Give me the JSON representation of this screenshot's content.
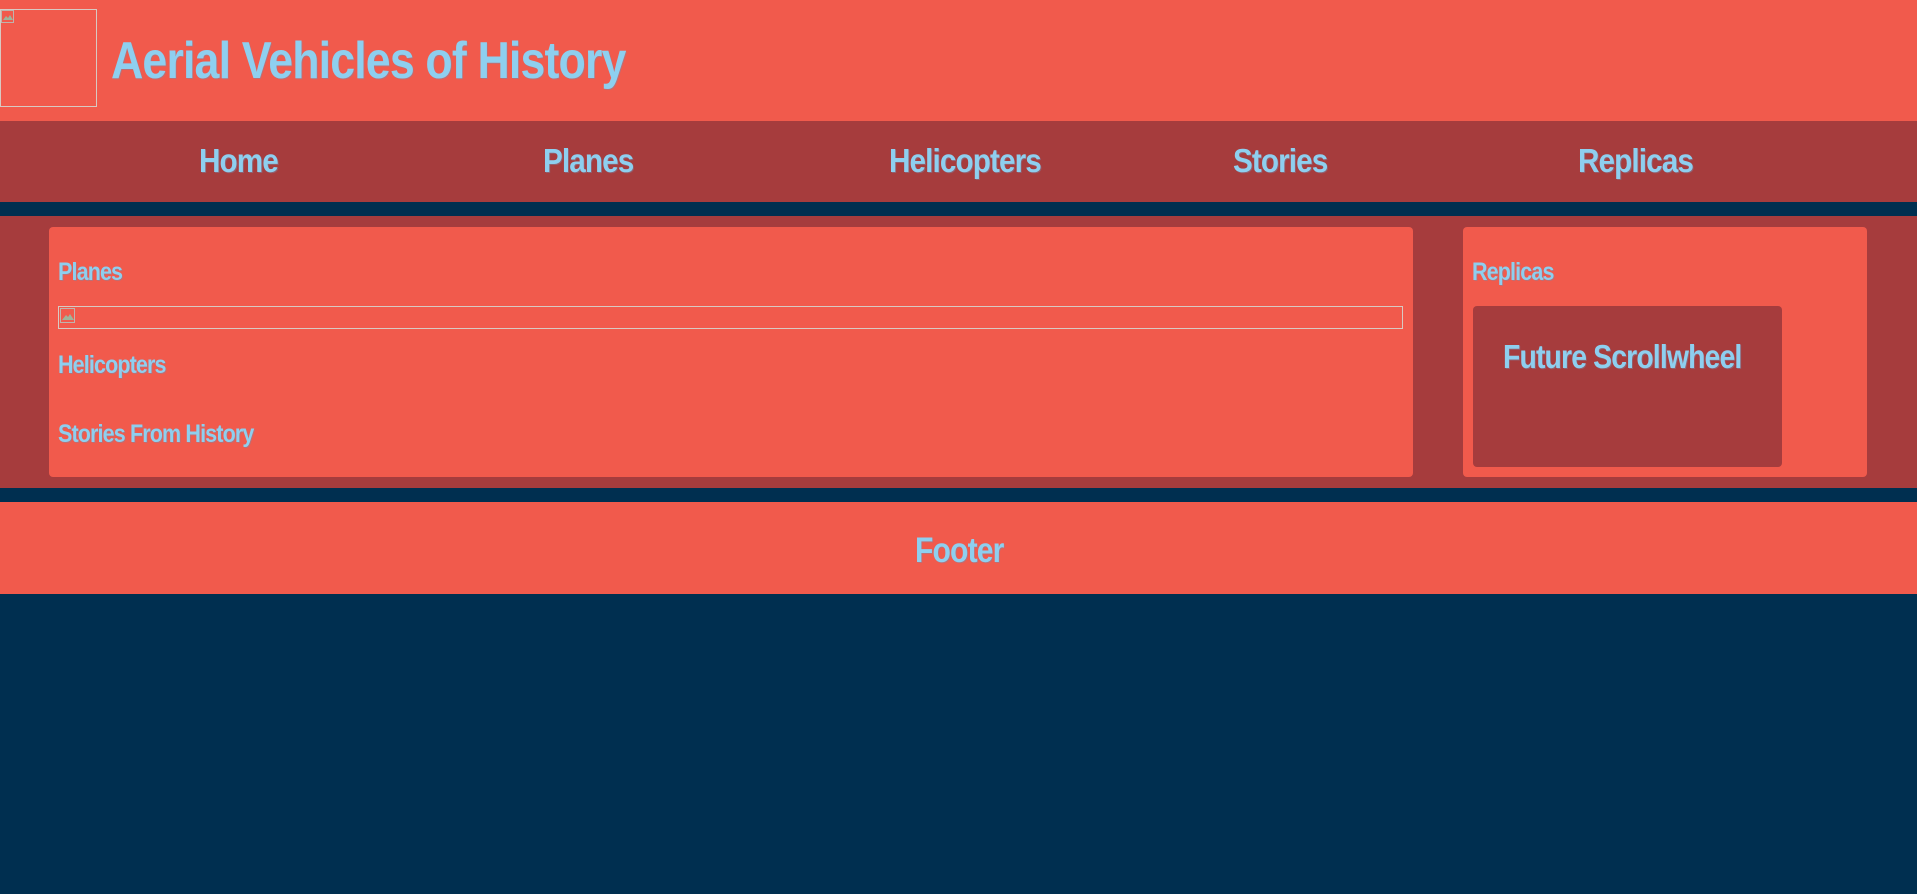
{
  "header": {
    "logo_icon": "broken-image-icon",
    "title": "Aerial Vehicles of History"
  },
  "nav": {
    "items": [
      {
        "label": "Home"
      },
      {
        "label": "Planes"
      },
      {
        "label": "Helicopters"
      },
      {
        "label": "Stories"
      },
      {
        "label": "Replicas"
      }
    ]
  },
  "main": {
    "planes_heading": "Planes",
    "image_icon": "broken-image-icon",
    "helicopters_heading": "Helicopters",
    "stories_heading": "Stories From History"
  },
  "sidebar": {
    "heading": "Replicas",
    "scrollwheel_label": "Future Scrollwheel"
  },
  "footer": {
    "label": "Footer"
  },
  "colors": {
    "page_background": "#002f50",
    "primary": "#f15a4c",
    "secondary": "#a63c3d",
    "text": "#8ecfef"
  }
}
